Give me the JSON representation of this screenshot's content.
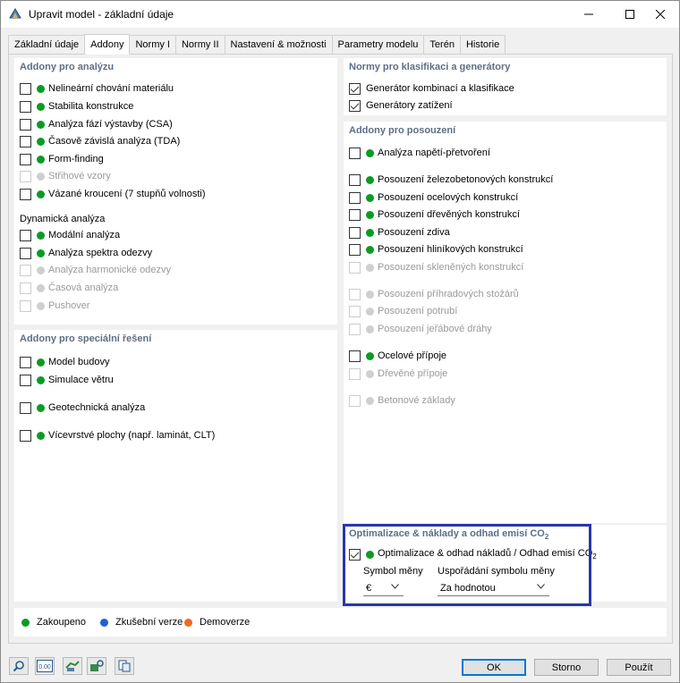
{
  "window": {
    "title": "Upravit model - základní údaje"
  },
  "tabs": [
    {
      "label": "Základní údaje"
    },
    {
      "label": "Addony"
    },
    {
      "label": "Normy I"
    },
    {
      "label": "Normy II"
    },
    {
      "label": "Nastavení & možnosti"
    },
    {
      "label": "Parametry modelu"
    },
    {
      "label": "Terén"
    },
    {
      "label": "Historie"
    }
  ],
  "active_tab": "Addony",
  "analysis": {
    "title": "Addony pro analýzu",
    "items": [
      {
        "label": "Nelineární chování materiálu",
        "checked": false,
        "status": "purchased"
      },
      {
        "label": "Stabilita konstrukce",
        "checked": false,
        "status": "purchased"
      },
      {
        "label": "Analýza fází výstavby (CSA)",
        "checked": false,
        "status": "purchased"
      },
      {
        "label": "Časově závislá analýza (TDA)",
        "checked": false,
        "status": "purchased"
      },
      {
        "label": "Form-finding",
        "checked": false,
        "status": "purchased"
      },
      {
        "label": "Střihové vzory",
        "checked": false,
        "status": "disabled"
      },
      {
        "label": "Vázané kroucení (7 stupňů volnosti)",
        "checked": false,
        "status": "purchased"
      }
    ],
    "dynamic_title": "Dynamická analýza",
    "dynamic_items": [
      {
        "label": "Modální analýza",
        "checked": false,
        "status": "purchased"
      },
      {
        "label": "Analýza spektra odezvy",
        "checked": false,
        "status": "purchased"
      },
      {
        "label": "Analýza harmonické odezvy",
        "checked": false,
        "status": "disabled"
      },
      {
        "label": "Časová analýza",
        "checked": false,
        "status": "disabled"
      },
      {
        "label": "Pushover",
        "checked": false,
        "status": "disabled"
      }
    ]
  },
  "special": {
    "title": "Addony pro speciální řešení",
    "items": [
      {
        "label": "Model budovy",
        "checked": false,
        "status": "purchased"
      },
      {
        "label": "Simulace větru",
        "checked": false,
        "status": "purchased"
      },
      {
        "label": "Geotechnická analýza",
        "checked": false,
        "status": "purchased"
      },
      {
        "label": "Vícevrstvé plochy (např. laminát, CLT)",
        "checked": false,
        "status": "purchased"
      }
    ]
  },
  "standards": {
    "title": "Normy pro klasifikaci a generátory",
    "items": [
      {
        "label": "Generátor kombinací a klasifikace",
        "checked": true
      },
      {
        "label": "Generátory zatížení",
        "checked": true
      }
    ]
  },
  "design": {
    "title": "Addony pro posouzení",
    "items": [
      {
        "label": "Analýza napětí-přetvoření",
        "checked": false,
        "status": "purchased"
      },
      {
        "label": "Posouzení železobetonových konstrukcí",
        "checked": false,
        "status": "purchased"
      },
      {
        "label": "Posouzení ocelových konstrukcí",
        "checked": false,
        "status": "purchased"
      },
      {
        "label": "Posouzení dřevěných konstrukcí",
        "checked": false,
        "status": "purchased"
      },
      {
        "label": "Posouzení zdiva",
        "checked": false,
        "status": "purchased"
      },
      {
        "label": "Posouzení hliníkových konstrukcí",
        "checked": false,
        "status": "purchased"
      },
      {
        "label": "Posouzení skleněných konstrukcí",
        "checked": false,
        "status": "disabled"
      },
      {
        "label": "Posouzení příhradových stožárů",
        "checked": false,
        "status": "disabled"
      },
      {
        "label": "Posouzení potrubí",
        "checked": false,
        "status": "disabled"
      },
      {
        "label": "Posouzení jeřábové dráhy",
        "checked": false,
        "status": "disabled"
      },
      {
        "label": "Ocelové přípoje",
        "checked": false,
        "status": "purchased"
      },
      {
        "label": "Dřevěné přípoje",
        "checked": false,
        "status": "disabled"
      },
      {
        "label": "Betonové základy",
        "checked": false,
        "status": "disabled"
      }
    ]
  },
  "optimization": {
    "title_main": "Optimalizace & náklady a odhad emisí CO",
    "title_sub": "2",
    "item_label_main": "Optimalizace & odhad nákladů / Odhad emisí CO",
    "item_label_sub": "2",
    "item_checked": true,
    "currency_label": "Symbol měny",
    "currency_value": "€",
    "arrangement_label": "Uspořádání symbolu měny",
    "arrangement_value": "Za hodnotou"
  },
  "legend": {
    "purchased": "Zakoupeno",
    "trial": "Zkušební verze",
    "demo": "Demoverze"
  },
  "buttons": {
    "ok": "OK",
    "cancel": "Storno",
    "apply": "Použít"
  },
  "colors": {
    "purchased": "#0a9b24",
    "trial": "#1b63d8",
    "demo": "#ef6a1b",
    "disabled": "#cfcfcf",
    "section_title": "#5c6f87",
    "highlight": "#2a36a8"
  },
  "toolbar_icons": [
    "search-icon",
    "units-icon",
    "model-data-icon",
    "model-settings-icon",
    "copy-icon"
  ],
  "toolbar_labels": {
    "units": "0.00"
  }
}
